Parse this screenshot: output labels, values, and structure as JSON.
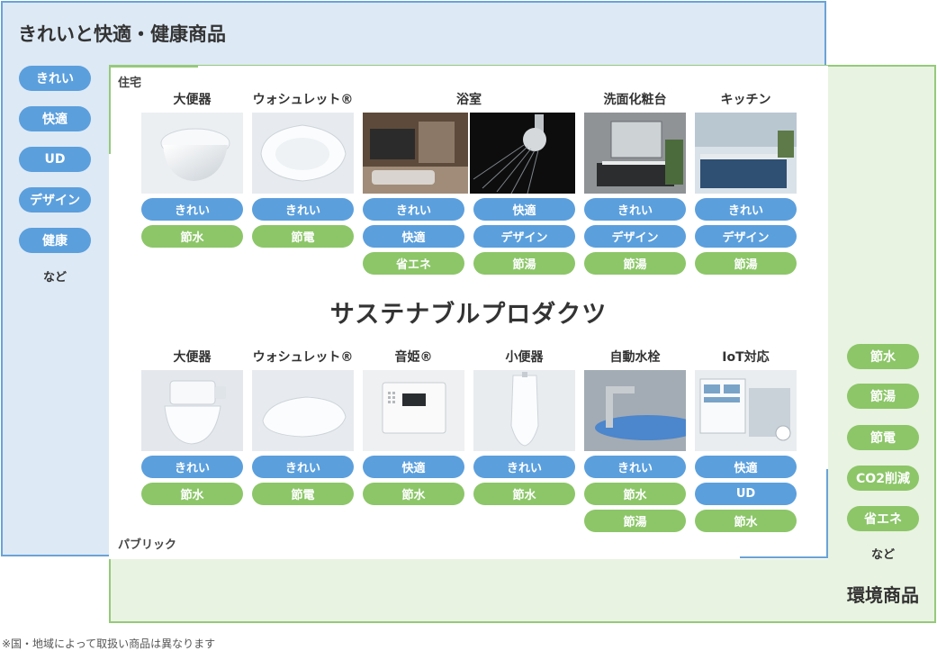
{
  "titles": {
    "left": "きれいと快適・健康商品",
    "right": "環境商品",
    "center": "サステナブルプロダクツ",
    "residential": "住宅",
    "public": "パブリック"
  },
  "left_pills": [
    "きれい",
    "快適",
    "UD",
    "デザイン",
    "健康"
  ],
  "left_nado": "など",
  "right_pills": [
    "節水",
    "節湯",
    "節電",
    "CO2削減",
    "省エネ"
  ],
  "right_nado": "など",
  "residential": {
    "categories": [
      {
        "label": "大便器",
        "tags": [
          "きれい",
          "節水"
        ]
      },
      {
        "label": "ウォシュレット®",
        "tags": [
          "きれい",
          "節電"
        ]
      },
      {
        "label": "浴室",
        "tags_left": [
          "きれい",
          "快適",
          "省エネ"
        ],
        "tags_right": [
          "快適",
          "デザイン",
          "節湯"
        ]
      },
      {
        "label": "洗面化粧台",
        "tags": [
          "きれい",
          "デザイン",
          "節湯"
        ]
      },
      {
        "label": "キッチン",
        "tags": [
          "きれい",
          "デザイン",
          "節湯"
        ]
      }
    ]
  },
  "public": {
    "categories": [
      {
        "label": "大便器",
        "tags": [
          "きれい",
          "節水"
        ]
      },
      {
        "label": "ウォシュレット®",
        "tags": [
          "きれい",
          "節電"
        ]
      },
      {
        "label": "音姫®",
        "tags": [
          "快適",
          "節水"
        ]
      },
      {
        "label": "小便器",
        "tags": [
          "きれい",
          "節水"
        ]
      },
      {
        "label": "自動水栓",
        "tags": [
          "きれい",
          "節水",
          "節湯"
        ]
      },
      {
        "label": "IoT対応",
        "tags": [
          "快適",
          "UD",
          "節水"
        ]
      }
    ]
  },
  "colors": {
    "blue_region": "#dde9f5",
    "blue_border": "#6aa3d6",
    "green_region": "#e8f3e1",
    "green_border": "#96c97a",
    "blue_pill": "#5b9fdd",
    "green_pill": "#8cc668"
  },
  "footnote": "※国・地域によって取扱い商品は異なります"
}
